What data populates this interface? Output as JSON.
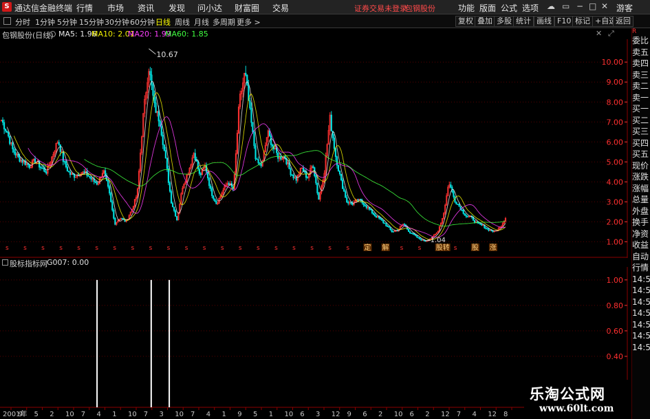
{
  "titlebar": {
    "logo": "S",
    "app_title": "通达信金融终端",
    "menus": [
      "行情",
      "市场",
      "资讯",
      "发现",
      "问小达",
      "财富圈",
      "交易"
    ],
    "broker_status": "证券交易未登录",
    "stock_name": "包钢股份",
    "right_menus": [
      "功能",
      "版面",
      "公式",
      "选项"
    ],
    "window_buttons": [
      "☁",
      "▭",
      "−",
      "□",
      "✕"
    ],
    "guest": "游客"
  },
  "toolbar": {
    "periods": [
      "分时",
      "1分钟",
      "5分钟",
      "15分钟",
      "30分钟",
      "60分钟",
      "日线",
      "周线",
      "月线",
      "多周期",
      "更多 >"
    ],
    "active_period": "日线",
    "tools": [
      "复权",
      "叠加",
      "多股",
      "统计",
      "画线",
      "F10",
      "标记",
      "+自选",
      "返回"
    ]
  },
  "infobar": {
    "stock_label": "包钢股份(日线)",
    "ma": [
      {
        "label": "MA5: 1.96",
        "color": "#e8e8e8"
      },
      {
        "label": "MA10: 2.01",
        "color": "#f0f000"
      },
      {
        "label": "MA20: 1.99",
        "color": "#ff40ff"
      },
      {
        "label": "MA60: 1.85",
        "color": "#40ff40"
      }
    ],
    "close_icon": "✕",
    "expand_icon": "⤢"
  },
  "right_column": {
    "ratio": "R",
    "items": [
      "委比",
      "卖五",
      "卖四",
      "卖三",
      "卖二",
      "卖一",
      "买一",
      "买二",
      "买三",
      "买四",
      "买五",
      "现价",
      "涨跌",
      "涨幅",
      "总量",
      "外盘",
      "换手",
      "净资",
      "收益",
      "自动",
      "行情",
      "14:5",
      "14:5",
      "14:5",
      "14:5",
      "14:5",
      "14:5",
      "14:5"
    ]
  },
  "sub_chart": {
    "name": "股标指标网",
    "value": "G007: 0.00",
    "y_ticks": [
      "1.00",
      "0.80",
      "0.60",
      "0.40"
    ]
  },
  "colors": {
    "up": "#ff3232",
    "down": "#00e0e0",
    "axis_red": "#8b0000",
    "grid": "#5a0000",
    "signal": "#ffffff"
  },
  "chart_data": [
    {
      "type": "candlestick",
      "title": "包钢股份(日线)",
      "y_ticks": [
        10.0,
        9.0,
        8.0,
        7.0,
        6.0,
        5.0,
        4.0,
        3.0,
        2.0,
        1.0
      ],
      "y_tick_labels": [
        "10.00",
        "9.00",
        "8.00",
        "7.00",
        "6.00",
        "5.00",
        "4.00",
        "3.00",
        "2.00",
        "1.00"
      ],
      "ylim": [
        0.6,
        10.8
      ],
      "annotations": [
        {
          "label": "10.67",
          "value": 10.67
        },
        {
          "label": "1.04",
          "value": 1.04
        }
      ],
      "approx_price_path": [
        7.1,
        6.5,
        5.6,
        5.2,
        5.0,
        4.8,
        5.1,
        4.7,
        4.5,
        5.3,
        6.1,
        5.0,
        4.4,
        4.3,
        4.5,
        4.4,
        4.1,
        3.9,
        4.6,
        3.5,
        1.9,
        2.2,
        2.0,
        2.6,
        3.4,
        7.2,
        9.8,
        7.8,
        7.0,
        5.1,
        3.0,
        2.1,
        3.8,
        4.5,
        5.5,
        4.3,
        4.8,
        3.5,
        2.9,
        3.5,
        4.0,
        3.6,
        8.0,
        9.5,
        7.2,
        5.0,
        4.8,
        6.5,
        5.7,
        5.2,
        5.3,
        4.5,
        4.1,
        4.7,
        4.2,
        4.9,
        3.1,
        4.5,
        7.2,
        5.3,
        4.0,
        3.0,
        2.9,
        3.1,
        2.9,
        2.6,
        2.3,
        2.1,
        1.8,
        1.5,
        1.6,
        1.9,
        1.5,
        1.3,
        1.1,
        1.04,
        1.2,
        1.5,
        2.3,
        4.0,
        3.1,
        2.7,
        2.3,
        2.2,
        1.9,
        1.8,
        1.6,
        1.5,
        1.7,
        2.2
      ],
      "markers": [
        "s",
        "s",
        "s",
        "s",
        "s",
        "s",
        "s",
        "s",
        "s",
        "s",
        "s",
        "s",
        "s",
        "s",
        "s",
        "s",
        "s",
        "s",
        "s",
        "s",
        "定",
        "解",
        "s",
        "s",
        "股转",
        "s",
        "股",
        "涨"
      ]
    },
    {
      "type": "bar",
      "title": "股标指标网",
      "series": [
        {
          "name": "G007",
          "values": [
            {
              "x": "2004-12",
              "y": 1.0
            },
            {
              "x": "2007-03",
              "y": 1.0
            },
            {
              "x": "2007-12",
              "y": 1.0
            }
          ]
        }
      ],
      "y_ticks": [
        1.0,
        0.8,
        0.6,
        0.4
      ],
      "ylim": [
        0,
        1.08
      ],
      "x_tick_labels": [
        "2001年",
        "9",
        "5",
        "2",
        "10",
        "7",
        "4",
        "1",
        "10",
        "7",
        "3",
        "10",
        "7",
        "4",
        "1",
        "9",
        "5",
        "1",
        "10",
        "6",
        "3",
        "12",
        "9",
        "6",
        "2",
        "10",
        "6",
        "2",
        "12",
        "7",
        "4",
        "12",
        "8"
      ]
    }
  ],
  "watermark": {
    "line1": "乐淘公式网",
    "line2": "www.60lt.com"
  }
}
